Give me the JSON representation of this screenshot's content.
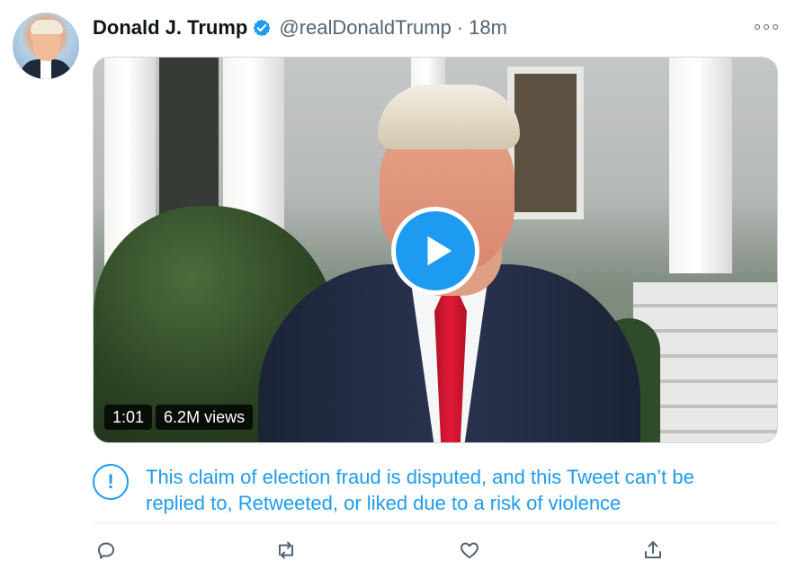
{
  "tweet": {
    "name": "Donald J. Trump",
    "handle": "@realDonaldTrump",
    "separator": "·",
    "time": "18m",
    "video": {
      "duration": "1:01",
      "views": "6.2M views"
    },
    "notice": {
      "line1": "This claim of election fraud is disputed, and this Tweet can’t be",
      "line2": "replied to, Retweeted, or liked due to a risk of violence"
    }
  },
  "icons": {
    "verified": "verified-badge-icon",
    "more": "more-options-icon",
    "play": "play-icon",
    "notice": "exclamation-circle-icon",
    "reply": "reply-icon",
    "retweet": "retweet-icon",
    "like": "heart-icon",
    "share": "share-icon"
  },
  "colors": {
    "accent": "#1d9bf0",
    "muted": "#536471",
    "text": "#0f1419"
  }
}
